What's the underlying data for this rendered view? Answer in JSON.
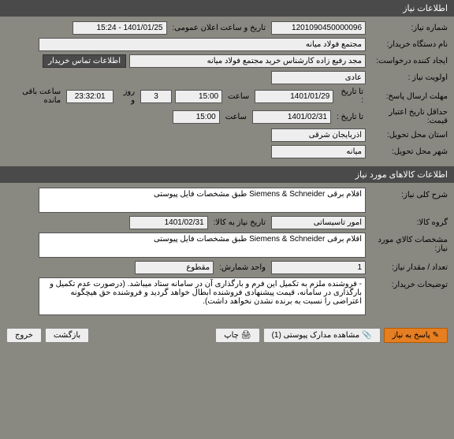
{
  "titles": {
    "main": "اطلاعات نیاز",
    "goods": "اطلاعات کالاهای مورد نیاز"
  },
  "labels": {
    "need_no": "شماره نیاز:",
    "announce_date": "تاریخ و ساعت اعلان عمومی:",
    "buyer": "نام دستگاه خریدار:",
    "requester": "ایجاد کننده درخواست:",
    "contact": "اطلاعات تماس خریدار",
    "priority": "اولویت نیاز :",
    "response_deadline": "مهلت ارسال پاسخ:",
    "until_date": "تا تاریخ :",
    "time": "ساعت",
    "day_and": "روز و",
    "remaining": "ساعت باقی مانده",
    "validity": "حداقل تاریخ اعتبار قیمت:",
    "delivery_province": "استان محل تحویل:",
    "delivery_city": "شهر محل تحویل:",
    "general_desc": "شرح کلی نیاز:",
    "goods_group": "گروه کالا:",
    "need_date": "تاریخ نیاز به کالا:",
    "goods_spec": "مشخصات كالاي مورد نياز:",
    "qty": "تعداد / مقدار نیاز:",
    "unit": "واحد شمارش:",
    "buyer_notes": "توضیحات خریدار:"
  },
  "values": {
    "need_no": "1201090450000096",
    "announce_date": "1401/01/25 - 15:24",
    "buyer": "مجتمع فولاد میانه",
    "requester": "مجد رفیع زاده کارشناس خرید مجتمع فولاد میانه",
    "priority": "عادی",
    "resp_date": "1401/01/29",
    "resp_time": "15:00",
    "remain_days": "3",
    "remain_time": "23:32:01",
    "validity_date": "1401/02/31",
    "validity_time": "15:00",
    "province": "آذربایجان شرقی",
    "city": "میانه",
    "general_desc": "اقلام برقی Siemens & Schneider طبق مشخصات فایل پیوستی",
    "goods_group": "امور تاسیساتی",
    "need_date": "1401/02/31",
    "goods_spec": "اقلام برقی Siemens & Schneider طبق مشخصات فایل پیوستی",
    "qty": "1",
    "unit": "مقطوع",
    "buyer_notes": "- فروشنده ملزم به تکمیل این فرم و بارگذاری آن در سامانه ستاد میباشد. (درصورت عدم تکمیل و بارگذاری در سامانه، قیمت پیشنهادی فروشنده ابطال خواهد گردید و فروشنده حق هیچگونه اعتراضی را نسبت به برنده نشدن نخواهد داشت)."
  },
  "buttons": {
    "respond": "پاسخ به نیاز",
    "attachments": "مشاهده مدارک پیوستی (1)",
    "print": "چاپ",
    "back": "بازگشت",
    "exit": "خروج"
  }
}
